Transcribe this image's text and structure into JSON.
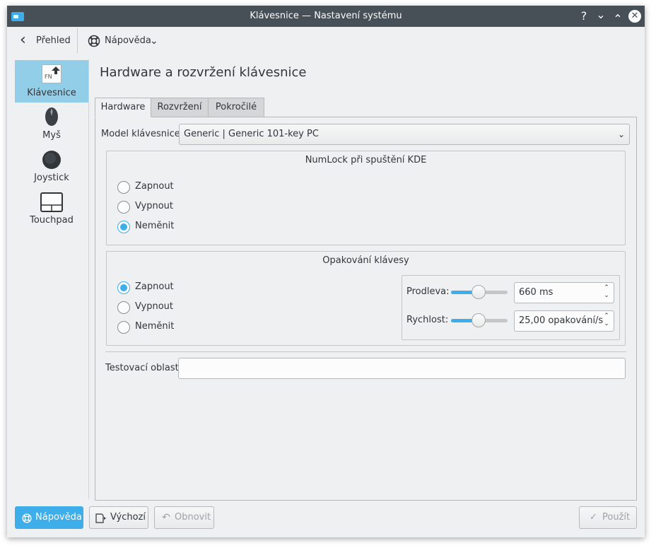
{
  "window": {
    "title": "Klávesnice  — Nastavení systému",
    "help_glyph": "?",
    "minimize_glyph": "⌄",
    "maximize_glyph": "⌃",
    "close_glyph": "✕"
  },
  "toolbar": {
    "back_glyph": "‹",
    "back_label": "Přehled",
    "help_label": "Nápověda",
    "help_chevron": "⌄"
  },
  "sidebar": {
    "items": [
      {
        "label": "Klávesnice",
        "icon": "keyboard-fn-icon",
        "icon_text": "FN",
        "selected": true
      },
      {
        "label": "Myš",
        "icon": "mouse-icon",
        "selected": false
      },
      {
        "label": "Joystick",
        "icon": "joystick-icon",
        "selected": false
      },
      {
        "label": "Touchpad",
        "icon": "touchpad-icon",
        "selected": false
      }
    ]
  },
  "main": {
    "title": "Hardware a rozvržení klávesnice",
    "tabs": [
      {
        "label": "Hardware",
        "active": true
      },
      {
        "label": "Rozvržení",
        "active": false
      },
      {
        "label": "Pokročilé",
        "active": false
      }
    ],
    "model_label": "Model klávesnice:",
    "model_value": "Generic | Generic 101-key PC",
    "numlock": {
      "title": "NumLock při spuštění KDE",
      "options": [
        "Zapnout",
        "Vypnout",
        "Neměnit"
      ],
      "selected_index": 2
    },
    "repeat": {
      "title": "Opakování klávesy",
      "options": [
        "Zapnout",
        "Vypnout",
        "Neměnit"
      ],
      "selected_index": 0,
      "delay_label": "Prodleva:",
      "delay_value": "660 ms",
      "delay_slider_fraction": 0.5,
      "rate_label": "Rychlost:",
      "rate_value": "25,00 opakování/s",
      "rate_slider_fraction": 0.5
    },
    "test_label": "Testovací oblast:",
    "test_value": ""
  },
  "footer": {
    "help_label": "Nápověda",
    "defaults_label": "Výchozí",
    "reset_label": "Obnovit",
    "reset_glyph": "↶",
    "apply_label": "Použít",
    "apply_glyph": "✓"
  },
  "colors": {
    "accent": "#3daee9",
    "titlebar": "#475057",
    "window_bg": "#eff0f1",
    "sidebar_selected": "#93cee9"
  },
  "icons": {
    "combo_arrow": "⌄",
    "spin_up": "⌃",
    "spin_down": "⌄"
  }
}
